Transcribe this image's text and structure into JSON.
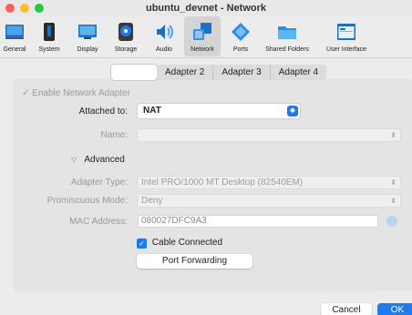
{
  "window": {
    "title": "ubuntu_devnet - Network"
  },
  "toolbar": [
    {
      "label": "General",
      "icon": "general-icon"
    },
    {
      "label": "System",
      "icon": "system-icon"
    },
    {
      "label": "Display",
      "icon": "display-icon"
    },
    {
      "label": "Storage",
      "icon": "storage-icon"
    },
    {
      "label": "Audio",
      "icon": "audio-icon"
    },
    {
      "label": "Network",
      "icon": "network-icon",
      "selected": true
    },
    {
      "label": "Ports",
      "icon": "ports-icon"
    },
    {
      "label": "Shared Folders",
      "icon": "shared-folders-icon"
    },
    {
      "label": "User Interface",
      "icon": "user-interface-icon"
    }
  ],
  "tabs": [
    "",
    "Adapter 2",
    "Adapter 3",
    "Adapter 4"
  ],
  "form": {
    "enable_adapter": "Enable Network Adapter",
    "attached_to_label": "Attached to:",
    "attached_to_value": "NAT",
    "name_label": "Name:",
    "name_value": "",
    "advanced_label": "Advanced",
    "adapter_type_label": "Adapter Type:",
    "adapter_type_value": "Intel PRO/1000 MT Desktop (82540EM)",
    "promiscuous_label": "Promiscuous Mode:",
    "promiscuous_value": "Deny",
    "mac_label": "MAC Address:",
    "mac_value": "080027DFC9A3",
    "cable_connected": "Cable Connected",
    "port_forwarding": "Port Forwarding"
  },
  "footer": {
    "cancel": "Cancel",
    "ok": "OK"
  },
  "colors": {
    "accent": "#1f7af0",
    "close": "#fe5f57",
    "minimize": "#febc2e",
    "maximize": "#28c840"
  }
}
